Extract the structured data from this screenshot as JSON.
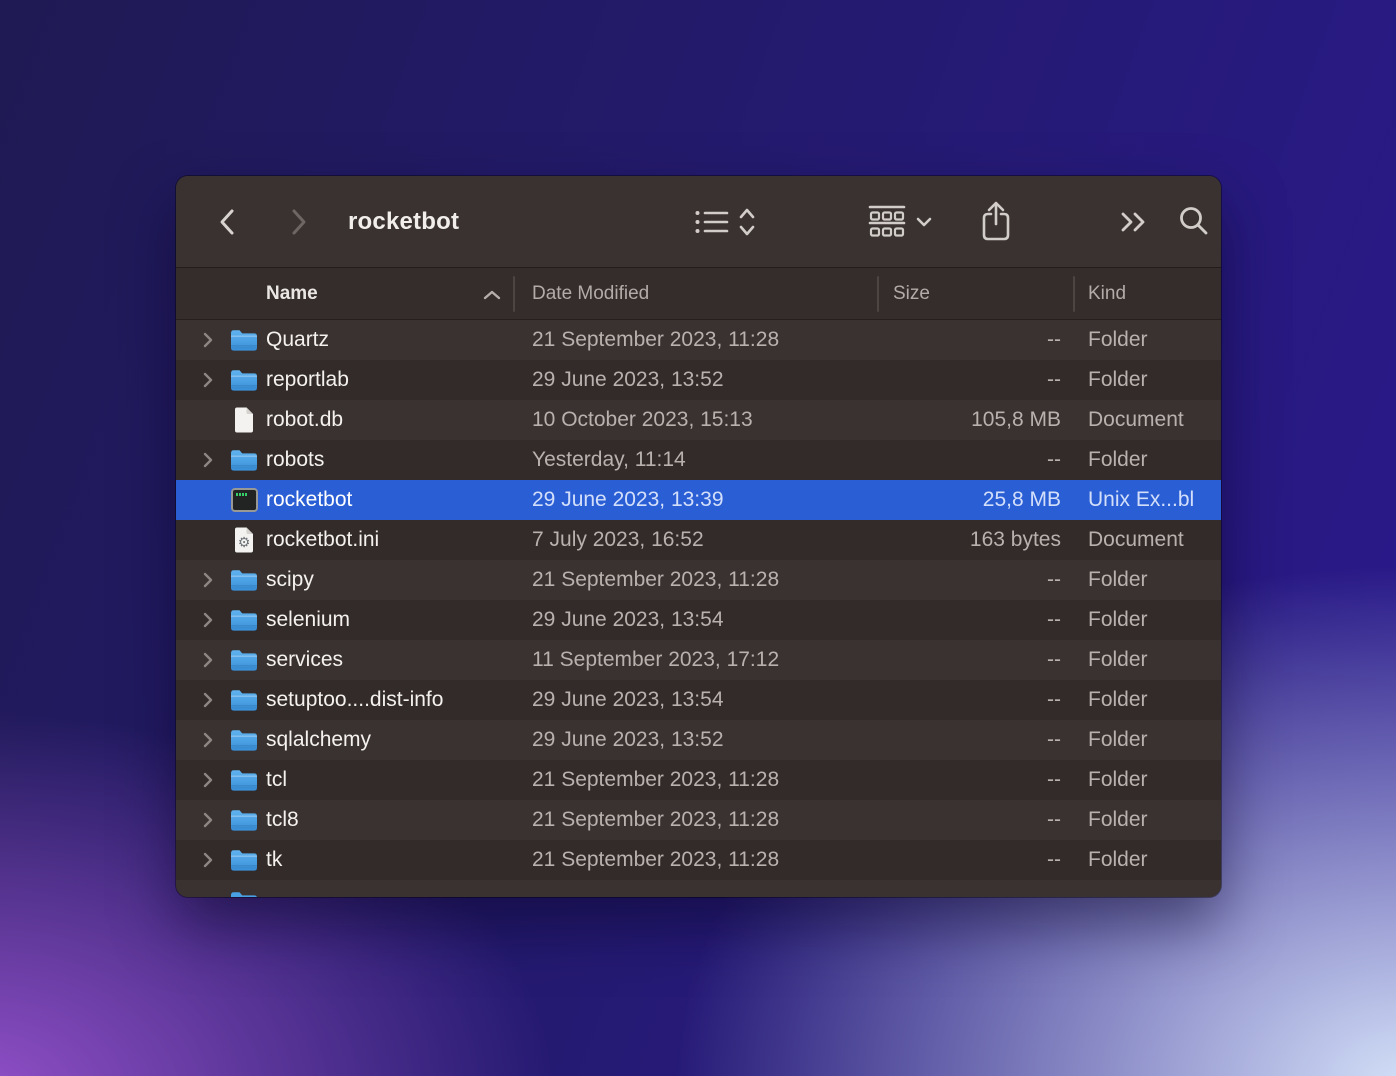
{
  "colors": {
    "selection_blue": "#2a5ed4",
    "folder_blue_top": "#5fb2ee",
    "folder_blue_bottom": "#3c92da",
    "toolbar_bg": "#393231",
    "row_light": "#3a3230",
    "row_dark": "#322b29",
    "background_gradient": [
      "#1f1a53",
      "#2a198e",
      "#9351ca",
      "#d4e1f8"
    ]
  },
  "toolbar": {
    "title": "rocketbot",
    "icons": {
      "back": "chevron-left",
      "forward": "chevron-right",
      "view_mode": "bulleted-list",
      "view_mode_picker": "chevrons-up-down",
      "group_by": "group-grid",
      "group_by_picker": "chevron-down",
      "share": "share-arrow-up",
      "more": "double-chevron-right",
      "search": "magnifier"
    }
  },
  "list": {
    "columns": [
      {
        "label": "Name",
        "sort": "ascending"
      },
      {
        "label": "Date Modified"
      },
      {
        "label": "Size"
      },
      {
        "label": "Kind"
      }
    ],
    "rows": [
      {
        "name": "Quartz",
        "date": "21 September 2023, 11:28",
        "size": "--",
        "kind": "Folder",
        "icon": "folder",
        "expandable": true,
        "selected": false
      },
      {
        "name": "reportlab",
        "date": "29 June 2023, 13:52",
        "size": "--",
        "kind": "Folder",
        "icon": "folder",
        "expandable": true,
        "selected": false
      },
      {
        "name": "robot.db",
        "date": "10 October 2023, 15:13",
        "size": "105,8 MB",
        "kind": "Document",
        "icon": "document",
        "expandable": false,
        "selected": false
      },
      {
        "name": "robots",
        "date": "Yesterday, 11:14",
        "size": "--",
        "kind": "Folder",
        "icon": "folder",
        "expandable": true,
        "selected": false
      },
      {
        "name": "rocketbot",
        "date": "29 June 2023, 13:39",
        "size": "25,8 MB",
        "kind": "Unix Ex...bl",
        "icon": "executable",
        "expandable": false,
        "selected": true
      },
      {
        "name": "rocketbot.ini",
        "date": "7 July 2023, 16:52",
        "size": "163 bytes",
        "kind": "Document",
        "icon": "ini-document",
        "expandable": false,
        "selected": false
      },
      {
        "name": "scipy",
        "date": "21 September 2023, 11:28",
        "size": "--",
        "kind": "Folder",
        "icon": "folder",
        "expandable": true,
        "selected": false
      },
      {
        "name": "selenium",
        "date": "29 June 2023, 13:54",
        "size": "--",
        "kind": "Folder",
        "icon": "folder",
        "expandable": true,
        "selected": false
      },
      {
        "name": "services",
        "date": "11 September 2023, 17:12",
        "size": "--",
        "kind": "Folder",
        "icon": "folder",
        "expandable": true,
        "selected": false
      },
      {
        "name": "setuptoo....dist-info",
        "date": "29 June 2023, 13:54",
        "size": "--",
        "kind": "Folder",
        "icon": "folder",
        "expandable": true,
        "selected": false
      },
      {
        "name": "sqlalchemy",
        "date": "29 June 2023, 13:52",
        "size": "--",
        "kind": "Folder",
        "icon": "folder",
        "expandable": true,
        "selected": false
      },
      {
        "name": "tcl",
        "date": "21 September 2023, 11:28",
        "size": "--",
        "kind": "Folder",
        "icon": "folder",
        "expandable": true,
        "selected": false
      },
      {
        "name": "tcl8",
        "date": "21 September 2023, 11:28",
        "size": "--",
        "kind": "Folder",
        "icon": "folder",
        "expandable": true,
        "selected": false
      },
      {
        "name": "tk",
        "date": "21 September 2023, 11:28",
        "size": "--",
        "kind": "Folder",
        "icon": "folder",
        "expandable": true,
        "selected": false
      }
    ],
    "partial_row": {
      "icon": "folder"
    }
  }
}
